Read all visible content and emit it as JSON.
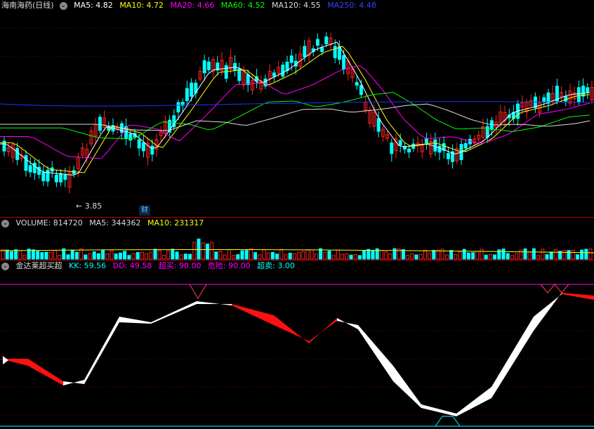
{
  "main_chart": {
    "title": "海南海药(日线)",
    "indicators": [
      {
        "label": "MA5: 4.82",
        "color": "#ffffff"
      },
      {
        "label": "MA10: 4.72",
        "color": "#ffff00"
      },
      {
        "label": "MA20: 4.66",
        "color": "#ff00ff"
      },
      {
        "label": "MA60: 4.52",
        "color": "#00ff00"
      },
      {
        "label": "MA120: 4.55",
        "color": "#dddddd"
      },
      {
        "label": "MA250: 4.48",
        "color": "#3344ff"
      }
    ],
    "low_marker": "3.85",
    "event_badge": "财"
  },
  "volume_panel": {
    "indicators": [
      {
        "label": "VOLUME: 814720",
        "color": "#dddddd"
      },
      {
        "label": "MA5: 344362",
        "color": "#dddddd"
      },
      {
        "label": "MA10: 231317",
        "color": "#ffff00"
      }
    ]
  },
  "oscillator_panel": {
    "title": "金达莱超买超",
    "indicators": [
      {
        "label": "KK: 59.56",
        "color": "#00ffff"
      },
      {
        "label": "DD: 49.58",
        "color": "#ff00ff"
      },
      {
        "label": "超买: 90.00",
        "color": "#ff00ff"
      },
      {
        "label": "危险: 90.00",
        "color": "#ff00ff"
      },
      {
        "label": "超卖: 3.00",
        "color": "#00ffff"
      }
    ]
  },
  "colors": {
    "up": "#ff2020",
    "down": "#00ffff",
    "background": "#000000",
    "grid": "#550000"
  },
  "chart_data": [
    {
      "type": "candlestick",
      "title": "海南海药(日线)",
      "series": [
        {
          "name": "MA5",
          "last": 4.82
        },
        {
          "name": "MA10",
          "last": 4.72
        },
        {
          "name": "MA20",
          "last": 4.66
        },
        {
          "name": "MA60",
          "last": 4.52
        },
        {
          "name": "MA120",
          "last": 4.55
        },
        {
          "name": "MA250",
          "last": 4.48
        }
      ],
      "annotations": [
        "3.85"
      ]
    },
    {
      "type": "bar",
      "series": [
        {
          "name": "VOLUME",
          "last": 814720
        },
        {
          "name": "MA5",
          "last": 344362
        },
        {
          "name": "MA10",
          "last": 231317
        }
      ]
    },
    {
      "type": "area",
      "series": [
        {
          "name": "KK",
          "last": 59.56
        },
        {
          "name": "DD",
          "last": 49.58
        }
      ],
      "levels": [
        {
          "name": "超买",
          "value": 90.0
        },
        {
          "name": "危险",
          "value": 90.0
        },
        {
          "name": "超卖",
          "value": 3.0
        }
      ]
    }
  ]
}
